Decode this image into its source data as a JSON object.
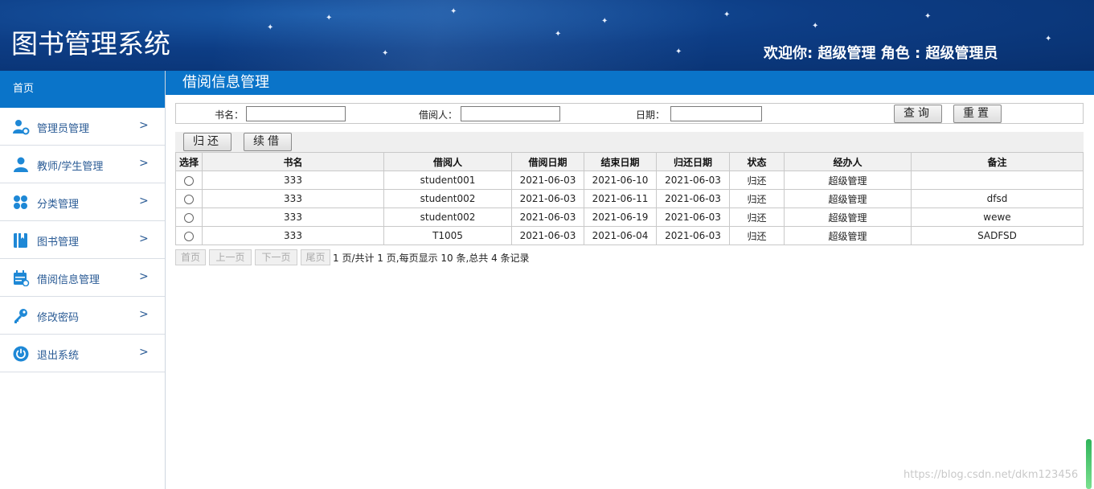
{
  "header": {
    "app_title": "图书管理系统",
    "welcome": "欢迎你: 超级管理 角色 : 超级管理员"
  },
  "sidebar": {
    "home": "首页",
    "items": [
      {
        "label": "管理员管理",
        "icon": "admin-user-gear-icon"
      },
      {
        "label": "教师/学生管理",
        "icon": "user-icon"
      },
      {
        "label": "分类管理",
        "icon": "category-grid-icon"
      },
      {
        "label": "图书管理",
        "icon": "book-icon"
      },
      {
        "label": "借阅信息管理",
        "icon": "calendar-icon"
      },
      {
        "label": "修改密码",
        "icon": "key-icon"
      },
      {
        "label": "退出系统",
        "icon": "power-icon"
      }
    ],
    "chevron": ">"
  },
  "main": {
    "title": "借阅信息管理",
    "search": {
      "book_label": "书名：",
      "book_value": "",
      "borrower_label": "借阅人：",
      "borrower_value": "",
      "date_label": "日期：",
      "date_value": "",
      "query_button": "查询",
      "reset_button": "重置"
    },
    "toolbar": {
      "return_button": "归还",
      "renew_button": "续借"
    },
    "table": {
      "headers": [
        "选择",
        "书名",
        "借阅人",
        "借阅日期",
        "结束日期",
        "归还日期",
        "状态",
        "经办人",
        "备注"
      ],
      "rows": [
        [
          "",
          "333",
          "student001",
          "2021-06-03",
          "2021-06-10",
          "2021-06-03",
          "归还",
          "超级管理",
          ""
        ],
        [
          "",
          "333",
          "student002",
          "2021-06-03",
          "2021-06-11",
          "2021-06-03",
          "归还",
          "超级管理",
          "dfsd"
        ],
        [
          "",
          "333",
          "student002",
          "2021-06-03",
          "2021-06-19",
          "2021-06-03",
          "归还",
          "超级管理",
          "wewe"
        ],
        [
          "",
          "333",
          "T1005",
          "2021-06-03",
          "2021-06-04",
          "2021-06-03",
          "归还",
          "超级管理",
          "SADFSD"
        ]
      ]
    },
    "pager": {
      "first": "首页",
      "prev": "上一页",
      "next": "下一页",
      "last": "尾页",
      "info": "1 页/共计 1 页,每页显示 10 条,总共 4 条记录"
    }
  },
  "watermark": "https://blog.csdn.net/dkm123456",
  "colors": {
    "accent_blue": "#0a74c9",
    "header_dark": "#08306e",
    "sidebar_text": "#2a5b95",
    "icon_blue": "#1e88d6"
  }
}
